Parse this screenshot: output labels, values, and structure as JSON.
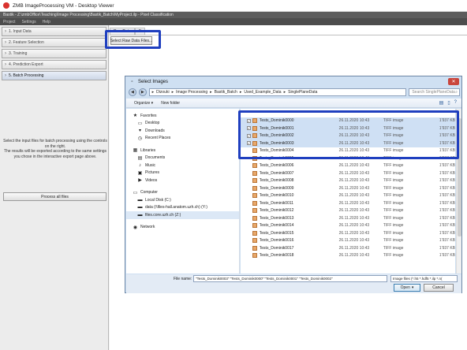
{
  "vm": {
    "title": "ZMB ImageProcessing VM - Desktop Viewer"
  },
  "app": {
    "title": "Bastik - Z:\\zmbOffice\\Teaching\\Image Processing\\Bastik_Batch\\MyProject.ilp - Pixel Classification",
    "menu": [
      "Project",
      "Settings",
      "Help"
    ]
  },
  "applets": [
    {
      "label": "1. Input Data"
    },
    {
      "label": "2. Feature Selection"
    },
    {
      "label": "3. Training"
    },
    {
      "label": "4. Prediction Export"
    },
    {
      "label": "5. Batch Processing"
    }
  ],
  "left": {
    "description": "Select the input files for batch processing using the controls on the right.\nThe results will be exported according to the same settings you chose in the interactive export page above.",
    "process_all": "Process all files"
  },
  "main": {
    "tabs": [
      "Raw Data",
      "F"
    ],
    "select_raw_button": "Select Raw Data Files..."
  },
  "dialog": {
    "title": "Select Images",
    "address": [
      "Dizouki",
      "Image Processing",
      "Bastik_Batch",
      "Used_Example_Data",
      "SinglePlaneData"
    ],
    "search_placeholder": "Search SinglePlaneData",
    "organize": "Organize",
    "new_folder": "New folder",
    "nav": {
      "favorites": {
        "label": "Favorites",
        "items": [
          "Desktop",
          "Downloads",
          "Recent Places"
        ]
      },
      "libraries": {
        "label": "Libraries",
        "items": [
          "Documents",
          "Music",
          "Pictures",
          "Videos"
        ]
      },
      "computer": {
        "label": "Computer",
        "items": [
          "Local Disk (C:)",
          "data (\\\\files-hall.anatom.uzh.ch) (Y:)",
          "files.core.uzh.ch (Z:)"
        ]
      },
      "network": {
        "label": "Network"
      }
    },
    "files": [
      {
        "name": "Tests_Dominik0000",
        "date": "26.11.2020 10:43",
        "type": "TIFF image",
        "size": "1'937 KB",
        "selected": true
      },
      {
        "name": "Tests_Dominik0001",
        "date": "26.11.2020 10:43",
        "type": "TIFF image",
        "size": "1'937 KB",
        "selected": true
      },
      {
        "name": "Tests_Dominik0002",
        "date": "26.11.2020 10:43",
        "type": "TIFF image",
        "size": "1'937 KB",
        "selected": true
      },
      {
        "name": "Tests_Dominik0003",
        "date": "26.11.2020 10:43",
        "type": "TIFF image",
        "size": "1'937 KB",
        "selected": true
      },
      {
        "name": "Tests_Dominik0004",
        "date": "26.11.2020 10:43",
        "type": "TIFF image",
        "size": "1'937 KB",
        "selected": false
      },
      {
        "name": "Tests_Dominik0005",
        "date": "26.11.2020 10:43",
        "type": "TIFF image",
        "size": "1'937 KB",
        "selected": false
      },
      {
        "name": "Tests_Dominik0006",
        "date": "26.11.2020 10:43",
        "type": "TIFF image",
        "size": "1'937 KB",
        "selected": false
      },
      {
        "name": "Tests_Dominik0007",
        "date": "26.11.2020 10:43",
        "type": "TIFF image",
        "size": "1'937 KB",
        "selected": false
      },
      {
        "name": "Tests_Dominik0008",
        "date": "26.11.2020 10:43",
        "type": "TIFF image",
        "size": "1'937 KB",
        "selected": false
      },
      {
        "name": "Tests_Dominik0009",
        "date": "26.11.2020 10:43",
        "type": "TIFF image",
        "size": "1'937 KB",
        "selected": false
      },
      {
        "name": "Tests_Dominik0010",
        "date": "26.11.2020 10:43",
        "type": "TIFF image",
        "size": "1'937 KB",
        "selected": false
      },
      {
        "name": "Tests_Dominik0011",
        "date": "26.11.2020 10:43",
        "type": "TIFF image",
        "size": "1'937 KB",
        "selected": false
      },
      {
        "name": "Tests_Dominik0012",
        "date": "26.11.2020 10:43",
        "type": "TIFF image",
        "size": "1'937 KB",
        "selected": false
      },
      {
        "name": "Tests_Dominik0013",
        "date": "26.11.2020 10:43",
        "type": "TIFF image",
        "size": "1'937 KB",
        "selected": false
      },
      {
        "name": "Tests_Dominik0014",
        "date": "26.11.2020 10:43",
        "type": "TIFF image",
        "size": "1'937 KB",
        "selected": false
      },
      {
        "name": "Tests_Dominik0015",
        "date": "26.11.2020 10:43",
        "type": "TIFF image",
        "size": "1'937 KB",
        "selected": false
      },
      {
        "name": "Tests_Dominik0016",
        "date": "26.11.2020 10:43",
        "type": "TIFF image",
        "size": "1'937 KB",
        "selected": false
      },
      {
        "name": "Tests_Dominik0017",
        "date": "26.11.2020 10:43",
        "type": "TIFF image",
        "size": "1'937 KB",
        "selected": false
      },
      {
        "name": "Tests_Dominik0018",
        "date": "26.11.2020 10:43",
        "type": "TIFF image",
        "size": "1'937 KB",
        "selected": false
      }
    ],
    "filename_label": "File name:",
    "filename_value": "\"Tests_Dominik0003\" \"Tests_Dominik0000\" \"Tests_Dominik0001\" \"Tests_Dominik0002\"",
    "filetype_value": "Image files (*.h5 *.hdf5 *.ilp *.n(",
    "open_label": "Open",
    "cancel_label": "Cancel"
  },
  "colors": {
    "highlight": "#1f3fbf",
    "selection": "#cfe0f4"
  }
}
